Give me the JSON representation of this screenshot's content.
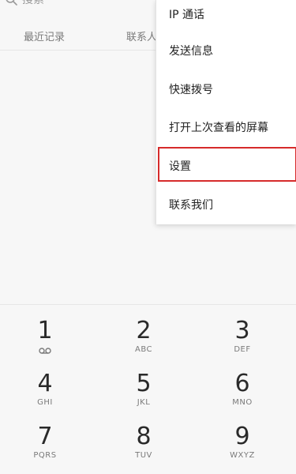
{
  "header": {
    "search_placeholder": "搜索",
    "search_icon": "search-icon",
    "tabs": [
      {
        "label": "最近记录"
      },
      {
        "label": "联系人"
      }
    ]
  },
  "menu": {
    "items": [
      {
        "label": "IP 通话"
      },
      {
        "label": "发送信息"
      },
      {
        "label": "快速拨号"
      },
      {
        "label": "打开上次查看的屏幕"
      },
      {
        "label": "设置"
      },
      {
        "label": "联系我们"
      }
    ],
    "highlight_color": "#d62b2b"
  },
  "keypad": {
    "keys": [
      {
        "digit": "1",
        "letters": "",
        "icon": "voicemail-icon"
      },
      {
        "digit": "2",
        "letters": "ABC"
      },
      {
        "digit": "3",
        "letters": "DEF"
      },
      {
        "digit": "4",
        "letters": "GHI"
      },
      {
        "digit": "5",
        "letters": "JKL"
      },
      {
        "digit": "6",
        "letters": "MNO"
      },
      {
        "digit": "7",
        "letters": "PQRS"
      },
      {
        "digit": "8",
        "letters": "TUV"
      },
      {
        "digit": "9",
        "letters": "WXYZ"
      }
    ]
  }
}
